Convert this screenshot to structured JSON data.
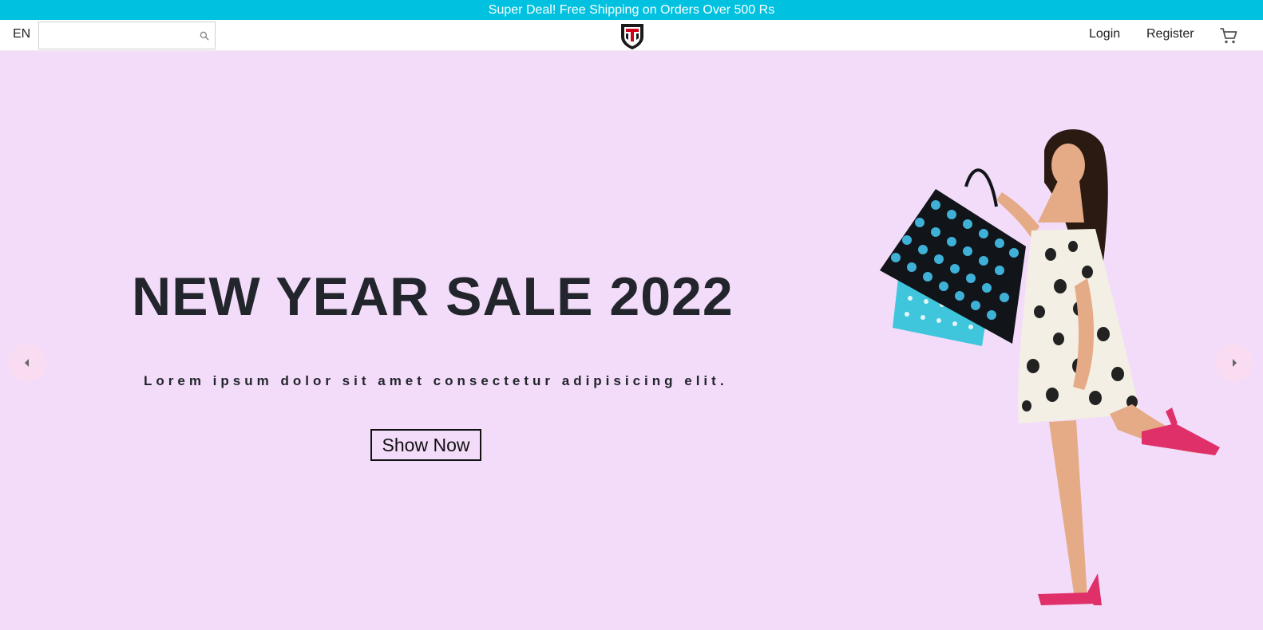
{
  "announcement": {
    "text": "Super Deal! Free Shipping on Orders Over 500 Rs"
  },
  "header": {
    "language": "EN",
    "search": {
      "value": "",
      "placeholder": ""
    },
    "links": {
      "login": "Login",
      "register": "Register"
    },
    "icons": {
      "search": "search-icon",
      "cart": "cart-icon",
      "logo": "shield-logo"
    }
  },
  "hero": {
    "title": "NEW YEAR SALE 2022",
    "subtitle": "Lorem ipsum dolor sit amet consectetur adipisicing elit.",
    "cta_label": "Show Now",
    "image": "woman holding polka-dot shopping bags"
  },
  "colors": {
    "announcement_bg": "#00c2e0",
    "hero_bg": "#f3dcfa",
    "heading_text": "#22252b"
  }
}
